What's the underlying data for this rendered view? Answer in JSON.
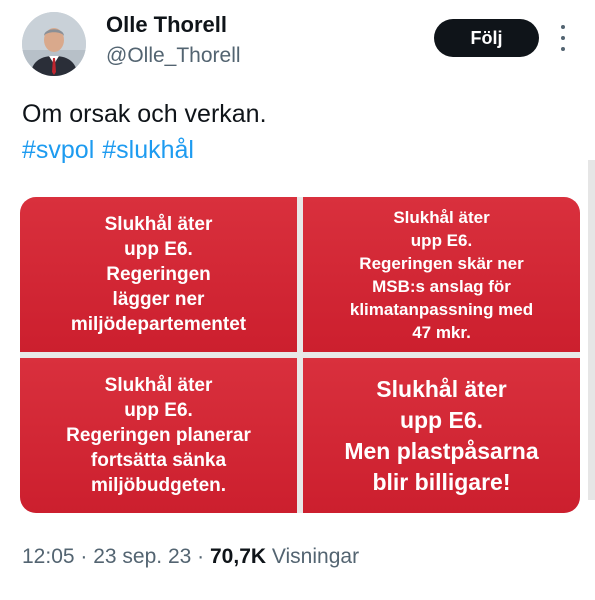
{
  "author": {
    "name": "Olle Thorell",
    "handle": "@Olle_Thorell",
    "follow_label": "Följ"
  },
  "tweet": {
    "text": "Om orsak och verkan.",
    "hashtags": [
      "#svpol",
      "#slukhål"
    ]
  },
  "media": {
    "tiles": [
      "Slukhål äter\nupp E6.\nRegeringen\nlägger ner\nmiljödepartementet",
      "Slukhål äter\nupp E6.\nRegeringen skär ner\nMSB:s anslag för\nklimatanpassning med\n47 mkr.",
      "Slukhål äter\nupp E6.\nRegeringen planerar\nfortsätta sänka\nmiljöbudgeten.",
      "Slukhål äter\nupp E6.\nMen plastpåsarna\nblir billigare!"
    ]
  },
  "meta": {
    "time": "12:05",
    "date": "23 sep. 23",
    "views_count": "70,7K",
    "views_label": "Visningar"
  },
  "colors": {
    "tile_red": "#d9303d",
    "hashtag_blue": "#1d9bf0",
    "follow_bg": "#0f1419"
  }
}
